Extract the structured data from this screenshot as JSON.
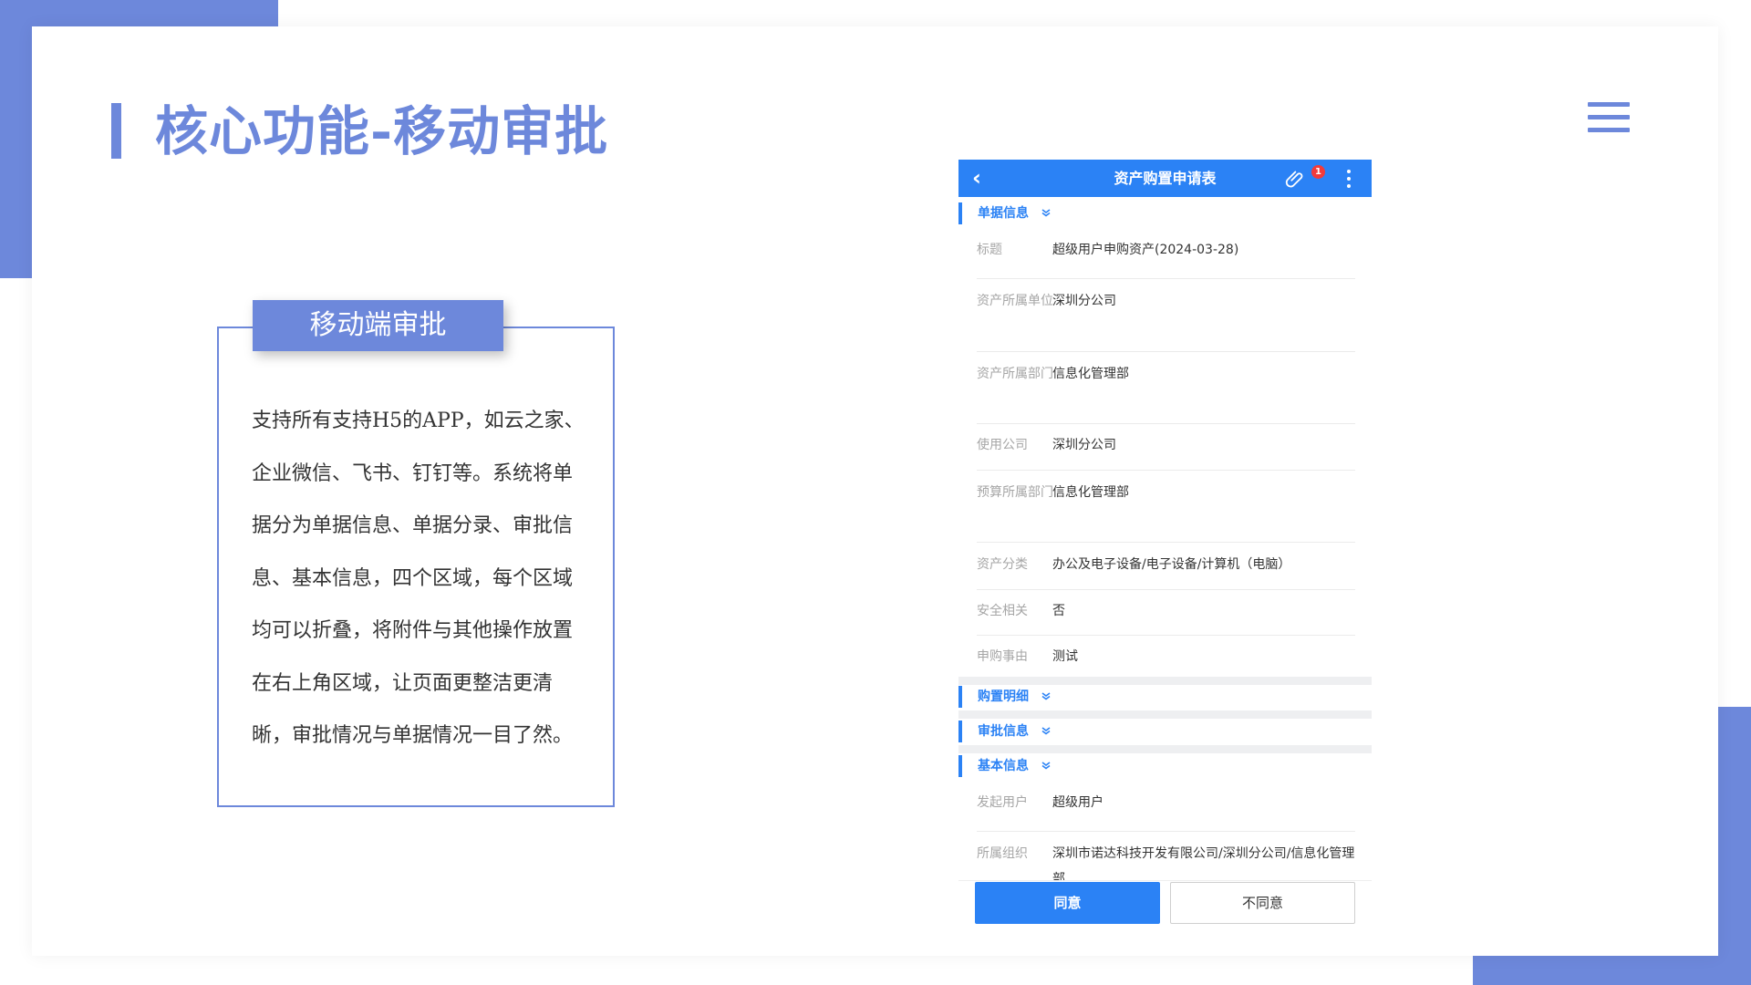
{
  "slide": {
    "title": "核心功能-移动审批",
    "accent_color": "#6d88db",
    "menu_icon": "hamburger-menu-icon"
  },
  "feature_box": {
    "label": "移动端审批",
    "description": "支持所有支持H5的APP，如云之家、企业微信、飞书、钉钉等。系统将单据分为单据信息、单据分录、审批信息、基本信息，四个区域，每个区域均可以折叠，将附件与其他操作放置在右上角区域，让页面更整洁更清晰，审批情况与单据情况一目了然。"
  },
  "phone": {
    "header": {
      "title": "资产购置申请表",
      "back_icon": "back-chevron-icon",
      "attachment_icon": "paperclip-icon",
      "attachment_badge": "1",
      "more_icon": "more-vertical-icon",
      "color": "#2b82f5"
    },
    "sections": [
      {
        "title": "单据信息"
      },
      {
        "title": "购置明细"
      },
      {
        "title": "审批信息"
      },
      {
        "title": "基本信息"
      }
    ],
    "doc_fields": [
      {
        "label": "标题",
        "value": "超级用户申购资产(2024-03-28)"
      },
      {
        "label": "资产所属单位",
        "value": "深圳分公司"
      },
      {
        "label": "资产所属部门",
        "value": "信息化管理部"
      },
      {
        "label": "使用公司",
        "value": "深圳分公司"
      },
      {
        "label": "预算所属部门",
        "value": "信息化管理部"
      },
      {
        "label": "资产分类",
        "value": "办公及电子设备/电子设备/计算机（电脑）"
      },
      {
        "label": "安全相关",
        "value": "否"
      },
      {
        "label": "申购事由",
        "value": "测试"
      }
    ],
    "basic_fields": [
      {
        "label": "发起用户",
        "value": "超级用户"
      },
      {
        "label": "所属组织",
        "value": "深圳市诺达科技开发有限公司/深圳分公司/信息化管理部"
      }
    ],
    "actions": {
      "agree": "同意",
      "disagree": "不同意"
    }
  }
}
